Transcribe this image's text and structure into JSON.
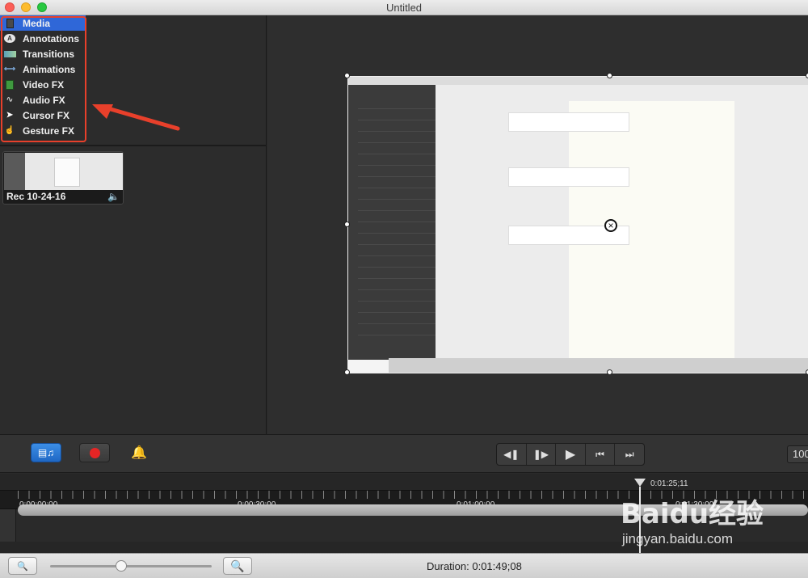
{
  "window": {
    "title": "Untitled"
  },
  "library": {
    "items": [
      {
        "label": "Media",
        "icon": "media-icon",
        "selected": true
      },
      {
        "label": "Annotations",
        "icon": "annotations-icon"
      },
      {
        "label": "Transitions",
        "icon": "transitions-icon"
      },
      {
        "label": "Animations",
        "icon": "animations-icon"
      },
      {
        "label": "Video FX",
        "icon": "video-fx-icon"
      },
      {
        "label": "Audio FX",
        "icon": "audio-fx-icon"
      },
      {
        "label": "Cursor FX",
        "icon": "cursor-fx-icon"
      },
      {
        "label": "Gesture FX",
        "icon": "gesture-fx-icon"
      }
    ],
    "clip": {
      "label": "Rec 10-24-16",
      "icon": "speaker-icon"
    }
  },
  "transport": {
    "buttons": [
      "step-back-icon",
      "step-forward-icon",
      "play-icon",
      "rewind-icon",
      "fast-forward-icon"
    ],
    "zoom_value": "100"
  },
  "timeline": {
    "ticks": [
      "0:00:00;00",
      "0:00:30;00",
      "0:01:00;00",
      "0:01:30;00"
    ],
    "playhead_time": "0:01:25;11"
  },
  "footer": {
    "duration": "Duration: 0:01:49;08",
    "zoom_slider": 0.42
  },
  "watermark": {
    "logo": "Baidu经验",
    "url": "jingyan.baidu.com"
  },
  "colors": {
    "accent": "#2f67d8",
    "highlight": "#e8402b",
    "record": "#e52525"
  }
}
